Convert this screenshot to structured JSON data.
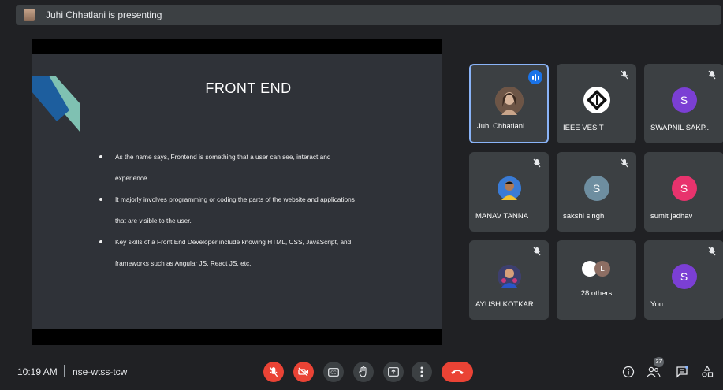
{
  "header": {
    "presenting_text": "Juhi Chhatlani is presenting"
  },
  "slide": {
    "title": "FRONT END",
    "bullets": [
      {
        "line1": "As the name says, Frontend is something that a user can see, interact and",
        "line2": "experience."
      },
      {
        "line1": "It majorly involves programming or coding the parts of the website and applications",
        "line2": "that are visible to the user."
      },
      {
        "line1": "Key skills of a Front End Developer include knowing HTML, CSS, JavaScript, and",
        "line2": "frameworks such as Angular JS, React JS, etc."
      }
    ]
  },
  "participants": [
    {
      "name": "Juhi Chhatlani",
      "avatar": "photo",
      "speaking": true,
      "muted": false
    },
    {
      "name": "IEEE VESIT",
      "avatar": "ieee-logo",
      "muted": true
    },
    {
      "name": "SWAPNIL SAKP...",
      "initial": "S",
      "avatar_color": "#7b3fd4",
      "muted": true
    },
    {
      "name": "MANAV TANNA",
      "avatar": "photo",
      "muted": true
    },
    {
      "name": "sakshi singh",
      "initial": "S",
      "avatar_color": "#6e8ea0",
      "muted": true
    },
    {
      "name": "sumit jadhav",
      "initial": "S",
      "avatar_color": "#e8336d",
      "muted": false
    },
    {
      "name": "AYUSH KOTKAR",
      "avatar": "photo",
      "muted": true
    },
    {
      "name": "28 others",
      "initial": "L",
      "others_count": "28 others",
      "muted": false
    },
    {
      "name": "You",
      "initial": "S",
      "avatar_color": "#7b3fd4",
      "muted": true
    }
  ],
  "footer": {
    "time": "10:19 AM",
    "meeting_code": "nse-wtss-tcw",
    "people_count": "37",
    "controls": [
      "mic-off",
      "camera-off",
      "captions",
      "raise-hand",
      "present",
      "more-options",
      "end-call"
    ]
  },
  "colors": {
    "background": "#202124",
    "tile": "#3c4043",
    "accent_blue": "#1a73e8",
    "red": "#ea4335"
  }
}
